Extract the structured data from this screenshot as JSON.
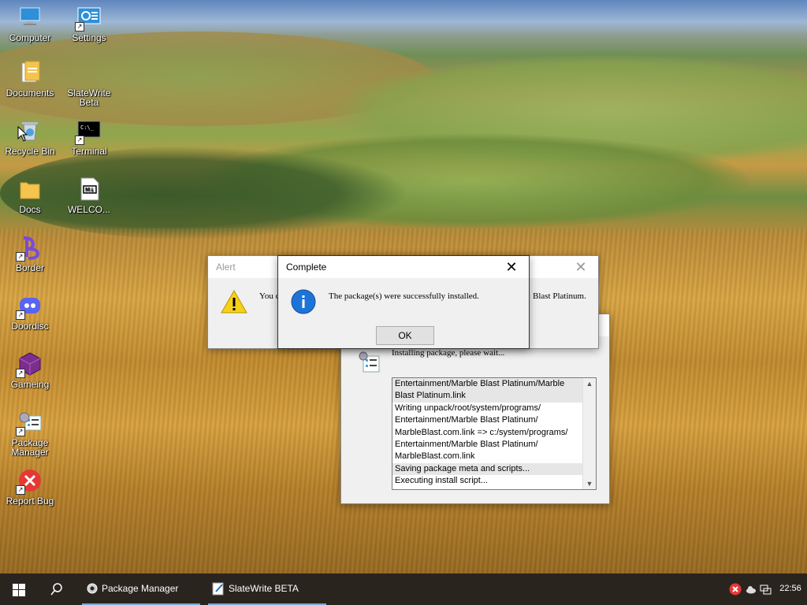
{
  "desktop": {
    "icons": [
      {
        "label": "Computer",
        "icon": "computer-icon"
      },
      {
        "label": "Settings",
        "icon": "settings-icon"
      },
      {
        "label": "Documents",
        "icon": "documents-icon"
      },
      {
        "label": "SlateWrite Beta",
        "icon": "slatewrite-icon"
      },
      {
        "label": "Recycle Bin",
        "icon": "recycle-bin-icon"
      },
      {
        "label": "Terminal",
        "icon": "terminal-icon"
      },
      {
        "label": "Docs",
        "icon": "folder-icon"
      },
      {
        "label": "WELCO...",
        "icon": "markdown-file-icon"
      },
      {
        "label": "Border",
        "icon": "border-icon"
      },
      {
        "label": "Doordisc",
        "icon": "discord-icon"
      },
      {
        "label": "Gameing",
        "icon": "cube-icon"
      },
      {
        "label": "Package Manager",
        "icon": "package-manager-icon"
      },
      {
        "label": "Report Bug",
        "icon": "report-bug-icon"
      }
    ]
  },
  "installer": {
    "status": "Installing package, please wait...",
    "log": [
      "Entertainment/Marble Blast Platinum/Marble",
      "Blast Platinum.link",
      "Writing unpack/root/system/programs/",
      "Entertainment/Marble Blast Platinum/",
      "MarbleBlast.com.link => c:/system/programs/",
      "Entertainment/Marble Blast Platinum/",
      "MarbleBlast.com.link",
      "Saving package meta and scripts...",
      "Executing install script..."
    ]
  },
  "alert": {
    "title": "Alert",
    "message_start": "You c",
    "message_end": "Blast Platinum.",
    "close": "✕"
  },
  "complete": {
    "title": "Complete",
    "message": "The package(s) were successfully installed.",
    "ok": "OK",
    "close": "✕"
  },
  "taskbar": {
    "items": [
      {
        "label": "Package Manager"
      },
      {
        "label": "SlateWrite BETA"
      }
    ],
    "clock": "22:56",
    "colors": {
      "background": "#2a241f",
      "active_underline": "#74a9d8"
    }
  }
}
